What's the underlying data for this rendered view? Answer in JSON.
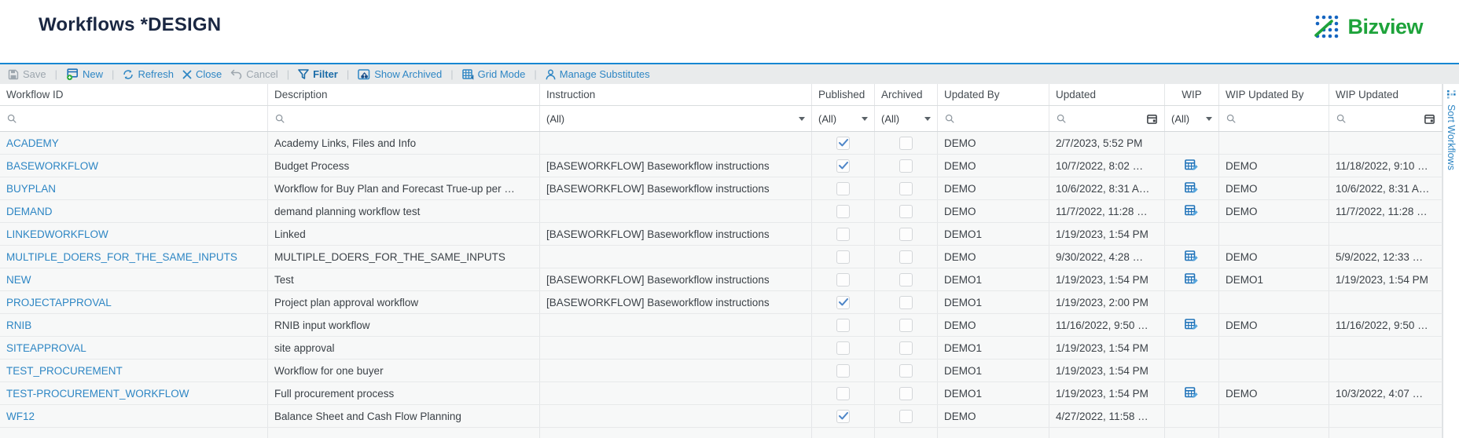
{
  "page": {
    "title": "Workflows *DESIGN"
  },
  "brand": {
    "name": "Bizview",
    "green": "#1ea33b",
    "blue": "#1565c0"
  },
  "toolbar": {
    "items": [
      {
        "label": "Save",
        "icon": "save",
        "enabled": false
      },
      {
        "sep": true
      },
      {
        "label": "New",
        "icon": "new",
        "enabled": true
      },
      {
        "sep": true
      },
      {
        "label": "Refresh",
        "icon": "refresh",
        "enabled": true
      },
      {
        "label": "Close",
        "icon": "close",
        "enabled": true
      },
      {
        "label": "Cancel",
        "icon": "cancel",
        "enabled": false
      },
      {
        "sep": true
      },
      {
        "label": "Filter",
        "icon": "filter",
        "enabled": true,
        "bold": true
      },
      {
        "sep": true
      },
      {
        "label": "Show Archived",
        "icon": "show-archived",
        "enabled": true
      },
      {
        "sep": true
      },
      {
        "label": "Grid Mode",
        "icon": "grid-mode",
        "enabled": true
      },
      {
        "sep": true
      },
      {
        "label": "Manage Substitutes",
        "icon": "manage-substitutes",
        "enabled": true
      }
    ]
  },
  "side_tab": {
    "label": "Sort Workflows"
  },
  "table": {
    "columns": [
      "Workflow ID",
      "Description",
      "Instruction",
      "Published",
      "Archived",
      "Updated By",
      "Updated",
      "WIP",
      "WIP Updated By",
      "WIP Updated"
    ],
    "filters": {
      "instruction": "(All)",
      "published": "(All)",
      "archived": "(All)",
      "wip": "(All)"
    },
    "rows": [
      {
        "id": "ACADEMY",
        "description": "Academy Links, Files and Info",
        "instruction": "",
        "published": true,
        "archived": false,
        "updated_by": "DEMO",
        "updated": "2/7/2023, 5:52 PM",
        "wip": false,
        "wip_updated_by": "",
        "wip_updated": ""
      },
      {
        "id": "BASEWORKFLOW",
        "description": "Budget Process",
        "instruction": "[BASEWORKFLOW] Baseworkflow instructions",
        "published": true,
        "archived": false,
        "updated_by": "DEMO",
        "updated": "10/7/2022, 8:02 …",
        "wip": true,
        "wip_updated_by": "DEMO",
        "wip_updated": "11/18/2022, 9:10 …"
      },
      {
        "id": "BUYPLAN",
        "description": "Workflow for Buy Plan and Forecast True-up per …",
        "instruction": "[BASEWORKFLOW] Baseworkflow instructions",
        "published": false,
        "archived": false,
        "updated_by": "DEMO",
        "updated": "10/6/2022, 8:31 A…",
        "wip": true,
        "wip_updated_by": "DEMO",
        "wip_updated": "10/6/2022, 8:31 A…"
      },
      {
        "id": "DEMAND",
        "description": "demand planning workflow test",
        "instruction": "",
        "published": false,
        "archived": false,
        "updated_by": "DEMO",
        "updated": "11/7/2022, 11:28 …",
        "wip": true,
        "wip_updated_by": "DEMO",
        "wip_updated": "11/7/2022, 11:28 …"
      },
      {
        "id": "LINKEDWORKFLOW",
        "description": "Linked",
        "instruction": "[BASEWORKFLOW] Baseworkflow instructions",
        "published": false,
        "archived": false,
        "updated_by": "DEMO1",
        "updated": "1/19/2023, 1:54 PM",
        "wip": false,
        "wip_updated_by": "",
        "wip_updated": ""
      },
      {
        "id": "MULTIPLE_DOERS_FOR_THE_SAME_INPUTS",
        "description": "MULTIPLE_DOERS_FOR_THE_SAME_INPUTS",
        "instruction": "",
        "published": false,
        "archived": false,
        "updated_by": "DEMO",
        "updated": "9/30/2022, 4:28 …",
        "wip": true,
        "wip_updated_by": "DEMO",
        "wip_updated": "5/9/2022, 12:33 …"
      },
      {
        "id": "NEW",
        "description": "Test",
        "instruction": "[BASEWORKFLOW] Baseworkflow instructions",
        "published": false,
        "archived": false,
        "updated_by": "DEMO1",
        "updated": "1/19/2023, 1:54 PM",
        "wip": true,
        "wip_updated_by": "DEMO1",
        "wip_updated": "1/19/2023, 1:54 PM"
      },
      {
        "id": "PROJECTAPPROVAL",
        "description": "Project plan approval workflow",
        "instruction": "[BASEWORKFLOW] Baseworkflow instructions",
        "published": true,
        "archived": false,
        "updated_by": "DEMO1",
        "updated": "1/19/2023, 2:00 PM",
        "wip": false,
        "wip_updated_by": "",
        "wip_updated": ""
      },
      {
        "id": "RNIB",
        "description": "RNIB input workflow",
        "instruction": "",
        "published": false,
        "archived": false,
        "updated_by": "DEMO",
        "updated": "11/16/2022, 9:50 …",
        "wip": true,
        "wip_updated_by": "DEMO",
        "wip_updated": "11/16/2022, 9:50 …"
      },
      {
        "id": "SITEAPPROVAL",
        "description": "site approval",
        "instruction": "",
        "published": false,
        "archived": false,
        "updated_by": "DEMO1",
        "updated": "1/19/2023, 1:54 PM",
        "wip": false,
        "wip_updated_by": "",
        "wip_updated": ""
      },
      {
        "id": "TEST_PROCUREMENT",
        "description": "Workflow for one buyer",
        "instruction": "",
        "published": false,
        "archived": false,
        "updated_by": "DEMO1",
        "updated": "1/19/2023, 1:54 PM",
        "wip": false,
        "wip_updated_by": "",
        "wip_updated": ""
      },
      {
        "id": "TEST-PROCUREMENT_WORKFLOW",
        "description": "Full procurement process",
        "instruction": "",
        "published": false,
        "archived": false,
        "updated_by": "DEMO1",
        "updated": "1/19/2023, 1:54 PM",
        "wip": true,
        "wip_updated_by": "DEMO",
        "wip_updated": "10/3/2022, 4:07 …"
      },
      {
        "id": "WF12",
        "description": "Balance Sheet and Cash Flow Planning",
        "instruction": "",
        "published": true,
        "archived": false,
        "updated_by": "DEMO",
        "updated": "4/27/2022, 11:58 …",
        "wip": false,
        "wip_updated_by": "",
        "wip_updated": ""
      }
    ]
  }
}
